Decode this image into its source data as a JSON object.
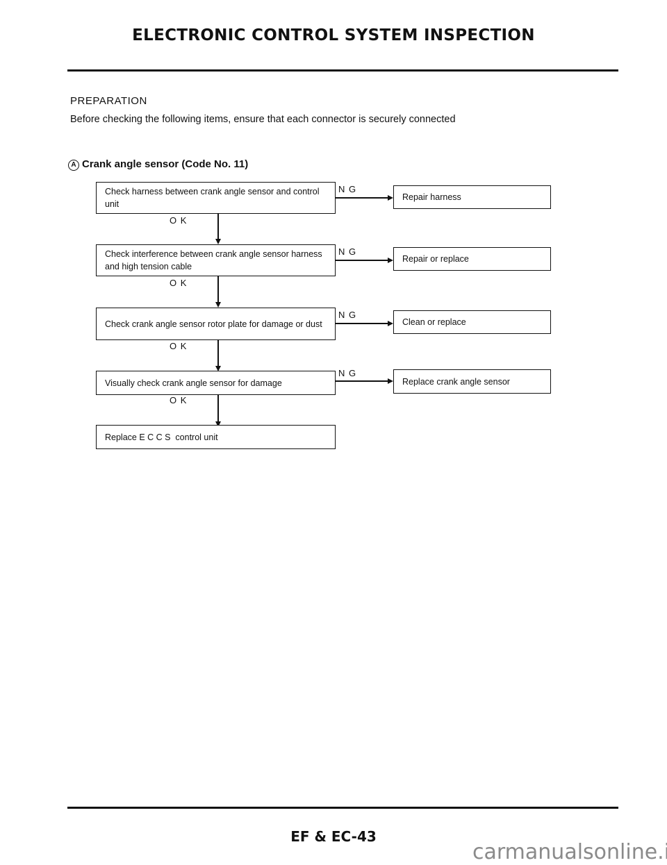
{
  "header": {
    "title": "ELECTRONIC CONTROL SYSTEM INSPECTION"
  },
  "preparation": {
    "heading": "PREPARATION",
    "text": "Before checking the following items, ensure that each connector is securely connected"
  },
  "section": {
    "marker": "A",
    "title": "Crank angle sensor (Code No. 11)"
  },
  "flowchart": {
    "steps": [
      {
        "check": "Check harness between crank angle sensor and control unit",
        "ng_action": "Repair harness"
      },
      {
        "check": "Check interference between crank angle sensor harness and high tension cable",
        "ng_action": "Repair or replace"
      },
      {
        "check": "Check crank angle sensor rotor plate for damage or dust",
        "ng_action": "Clean or replace"
      },
      {
        "check": "Visually check crank angle sensor for damage",
        "ng_action": "Replace crank angle sensor"
      }
    ],
    "final": "Replace E C C S  control unit",
    "ok_label": "O K",
    "ng_label": "N G"
  },
  "footer": {
    "page_number": "EF & EC-43"
  },
  "watermark": "carmanualsonline.info"
}
